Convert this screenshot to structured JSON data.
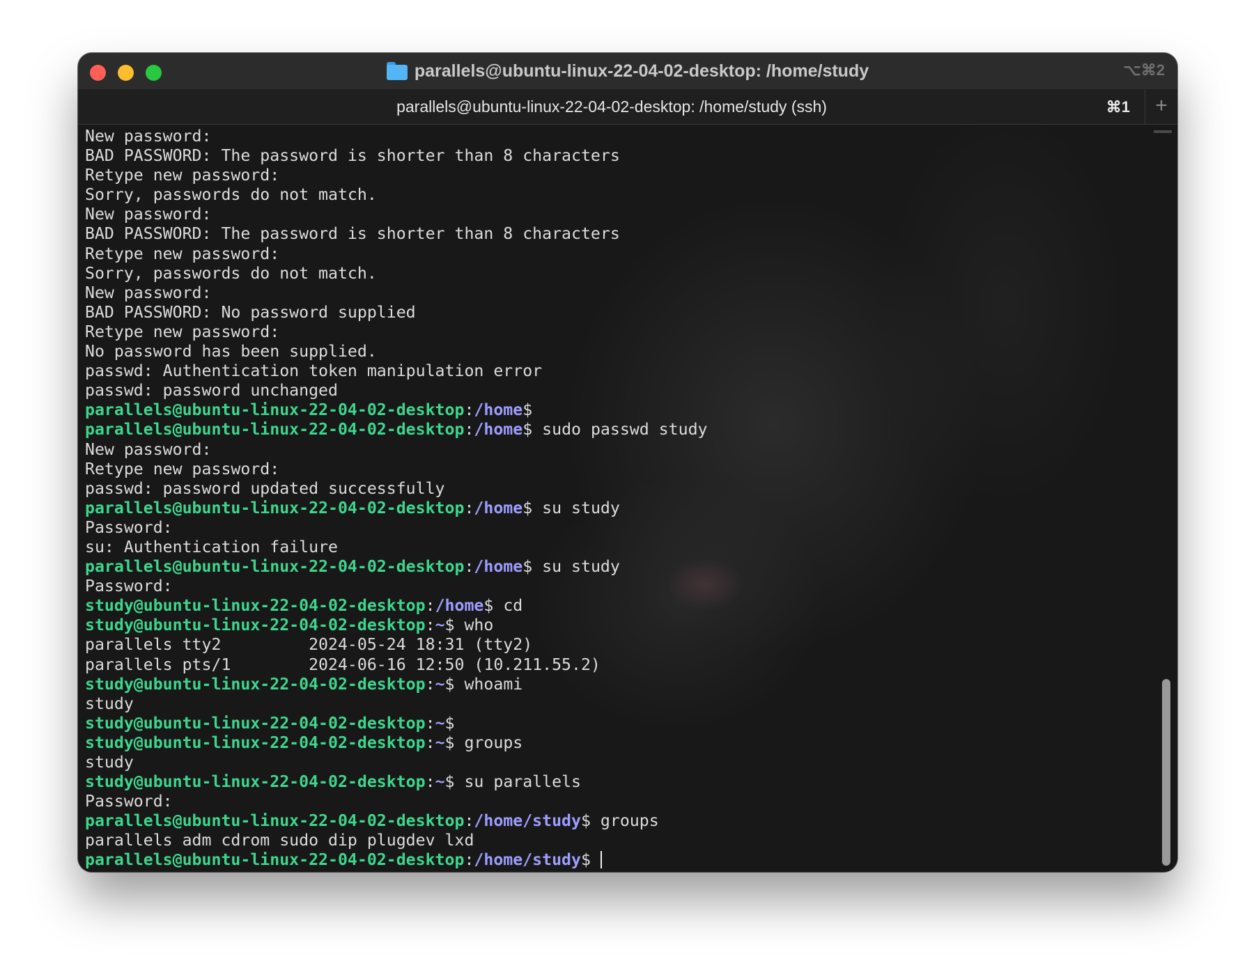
{
  "window": {
    "title": "parallels@ubuntu-linux-22-04-02-desktop: /home/study",
    "shortcut": "⌥⌘2",
    "folder_icon": "folder-icon"
  },
  "tab": {
    "title": "parallels@ubuntu-linux-22-04-02-desktop: /home/study (ssh)",
    "shortcut": "⌘1",
    "new_tab_icon": "plus-icon"
  },
  "colors": {
    "prompt_user": "#3dd68c",
    "prompt_path": "#9d9dff",
    "text": "#dcdcdc",
    "close": "#ff5f57",
    "minimize": "#febc2e",
    "zoom": "#28c840"
  },
  "terminal": {
    "lines": [
      {
        "text": "New password:"
      },
      {
        "text": "BAD PASSWORD: The password is shorter than 8 characters"
      },
      {
        "text": "Retype new password:"
      },
      {
        "text": "Sorry, passwords do not match."
      },
      {
        "text": "New password:"
      },
      {
        "text": "BAD PASSWORD: The password is shorter than 8 characters"
      },
      {
        "text": "Retype new password:"
      },
      {
        "text": "Sorry, passwords do not match."
      },
      {
        "text": "New password:"
      },
      {
        "text": "BAD PASSWORD: No password supplied"
      },
      {
        "text": "Retype new password:"
      },
      {
        "text": "No password has been supplied."
      },
      {
        "text": "passwd: Authentication token manipulation error"
      },
      {
        "text": "passwd: password unchanged"
      },
      {
        "prompt": {
          "user": "parallels@ubuntu-linux-22-04-02-desktop",
          "path": "/home"
        },
        "cmd": ""
      },
      {
        "prompt": {
          "user": "parallels@ubuntu-linux-22-04-02-desktop",
          "path": "/home"
        },
        "cmd": " sudo passwd study"
      },
      {
        "text": "New password:"
      },
      {
        "text": "Retype new password:"
      },
      {
        "text": "passwd: password updated successfully"
      },
      {
        "prompt": {
          "user": "parallels@ubuntu-linux-22-04-02-desktop",
          "path": "/home"
        },
        "cmd": " su study"
      },
      {
        "text": "Password:"
      },
      {
        "text": "su: Authentication failure"
      },
      {
        "prompt": {
          "user": "parallels@ubuntu-linux-22-04-02-desktop",
          "path": "/home"
        },
        "cmd": " su study"
      },
      {
        "text": "Password:"
      },
      {
        "prompt": {
          "user": "study@ubuntu-linux-22-04-02-desktop",
          "path": "/home"
        },
        "cmd": " cd"
      },
      {
        "prompt": {
          "user": "study@ubuntu-linux-22-04-02-desktop",
          "path": "~"
        },
        "cmd": " who"
      },
      {
        "text": "parallels tty2         2024-05-24 18:31 (tty2)"
      },
      {
        "text": "parallels pts/1        2024-06-16 12:50 (10.211.55.2)"
      },
      {
        "prompt": {
          "user": "study@ubuntu-linux-22-04-02-desktop",
          "path": "~"
        },
        "cmd": " whoami"
      },
      {
        "text": "study"
      },
      {
        "prompt": {
          "user": "study@ubuntu-linux-22-04-02-desktop",
          "path": "~"
        },
        "cmd": ""
      },
      {
        "prompt": {
          "user": "study@ubuntu-linux-22-04-02-desktop",
          "path": "~"
        },
        "cmd": " groups"
      },
      {
        "text": "study"
      },
      {
        "prompt": {
          "user": "study@ubuntu-linux-22-04-02-desktop",
          "path": "~"
        },
        "cmd": " su parallels"
      },
      {
        "text": "Password:"
      },
      {
        "prompt": {
          "user": "parallels@ubuntu-linux-22-04-02-desktop",
          "path": "/home/study"
        },
        "cmd": " groups"
      },
      {
        "text": "parallels adm cdrom sudo dip plugdev lxd"
      },
      {
        "prompt": {
          "user": "parallels@ubuntu-linux-22-04-02-desktop",
          "path": "/home/study"
        },
        "cmd": " ",
        "cursor": true
      }
    ]
  },
  "scrollbar": {
    "position": 0.74
  }
}
